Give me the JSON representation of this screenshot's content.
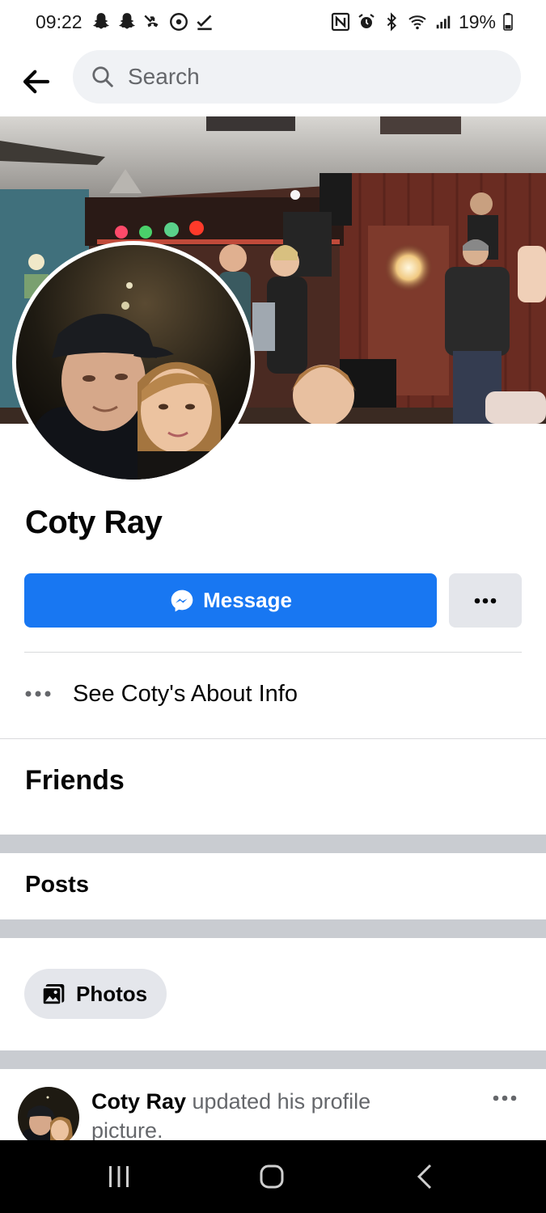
{
  "status_bar": {
    "time": "09:22",
    "battery": "19%",
    "left_icons": [
      "snapchat-icon",
      "snapchat-icon",
      "missed-call-icon",
      "location-icon",
      "download-done-icon"
    ],
    "right_icons": [
      "nfc-icon",
      "alarm-icon",
      "bluetooth-icon",
      "wifi-icon",
      "signal-icon",
      "battery-icon"
    ]
  },
  "search": {
    "placeholder": "Search"
  },
  "profile": {
    "name": "Coty Ray"
  },
  "actions": {
    "message_label": "Message"
  },
  "about": {
    "label": "See Coty's About Info"
  },
  "sections": {
    "friends": "Friends",
    "posts": "Posts"
  },
  "filters": {
    "photos_label": "Photos"
  },
  "post": {
    "author": "Coty Ray",
    "text": " updated his profile picture."
  },
  "colors": {
    "accent": "#1877f2",
    "secondary_button": "#e4e6eb",
    "search_bg": "#f0f2f5",
    "band": "#c9ccd1"
  }
}
